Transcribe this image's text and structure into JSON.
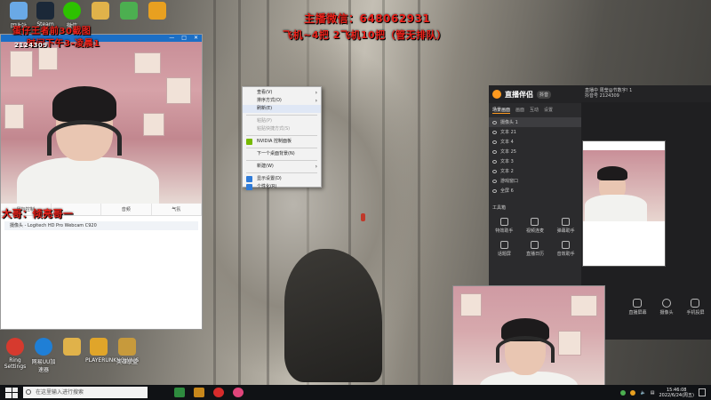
{
  "overlay": {
    "streamer_wechat": "主播微信：648062931",
    "pricing": "飞机~4把 2飞机10把（管无排队）",
    "notice_line1": "蛋仔王者前30截图",
    "notice_line2": "时间下午3-凌晨1",
    "captain": "大哥：倾亮哥一",
    "id_tag": "2124309"
  },
  "desktop_icons": [
    {
      "label": "回收站",
      "icon": "recycle-bin-icon",
      "color": "#6aa9e6"
    },
    {
      "label": "Steam",
      "icon": "steam-icon",
      "color": "#1b2838"
    },
    {
      "label": "微信",
      "icon": "wechat-icon",
      "color": "#2dc100"
    },
    {
      "label": "",
      "icon": "folder-icon",
      "color": "#e0b24a"
    },
    {
      "label": "",
      "icon": "play-icon",
      "color": "#4caf50"
    },
    {
      "label": "",
      "icon": "bar-chart-icon",
      "color": "#e8a020"
    }
  ],
  "bottom_desktop_icons": [
    {
      "label": "Ring Settings",
      "icon": "cat-icon",
      "color": "#d63a2e"
    },
    {
      "label": "网易UU加速器",
      "icon": "uu-icon",
      "color": "#1f7fd6"
    },
    {
      "label": "",
      "icon": "document-icon",
      "color": "#e0b24a"
    },
    {
      "label": "PLAYERUNKNOWN'S",
      "icon": "pubg-icon",
      "color": "#e0a52a"
    },
    {
      "label": "英雄联盟",
      "icon": "game-icon",
      "color": "#c79a3c"
    }
  ],
  "camera_window": {
    "tabs": [
      "鼠标控制",
      "",
      "音频",
      "气氛"
    ],
    "source": "摄像头 - Logitech HD Pro Webcam C920"
  },
  "context_menu": {
    "items": [
      {
        "label": "查看(V)",
        "arrow": true,
        "dim": false
      },
      {
        "label": "排序方式(O)",
        "arrow": true,
        "dim": false
      },
      {
        "label": "刷新(E)",
        "arrow": false,
        "dim": false,
        "highlight": true
      },
      {
        "sep": true
      },
      {
        "label": "粘贴(P)",
        "arrow": false,
        "dim": true
      },
      {
        "label": "粘贴快捷方式(S)",
        "arrow": false,
        "dim": true
      },
      {
        "sep": true
      },
      {
        "label": "NVIDIA 控制面板",
        "arrow": false,
        "dim": false,
        "icon": "#76b900"
      },
      {
        "sep": true
      },
      {
        "label": "下一个桌面背景(N)",
        "arrow": false,
        "dim": false
      },
      {
        "sep": true
      },
      {
        "label": "新建(W)",
        "arrow": true,
        "dim": false
      },
      {
        "sep": true
      },
      {
        "label": "显示设置(D)",
        "arrow": false,
        "dim": false,
        "icon": "#2f7bd8"
      },
      {
        "label": "个性化(R)",
        "arrow": false,
        "dim": false,
        "icon": "#2f7bd8"
      }
    ]
  },
  "bozhong": {
    "title": "直播伴侣",
    "badge": "抖音",
    "tabs": [
      "场景画面",
      "画面",
      "互动",
      "设置"
    ],
    "scenes": [
      "摄像头 1",
      "文本 21",
      "文本 4",
      "文本 25",
      "文本 3",
      "文本 2",
      "游戏窗口",
      "全屏 6"
    ],
    "toolbox_label": "工具箱",
    "tools": [
      "特效助手",
      "视频连麦",
      "弹幕助手",
      "话题屏",
      "直播日历",
      "音效助手"
    ],
    "topbar": "直播中 周莹@节数字! 1",
    "topbar2": "抖音号 2124309",
    "bottom_tools": [
      "直播屏幕",
      "摄像头",
      "手机投屏"
    ]
  },
  "taskbar": {
    "search_placeholder": "在这里输入进行搜索",
    "time": "15:46:08",
    "date": "2022/6/24(周五)"
  }
}
